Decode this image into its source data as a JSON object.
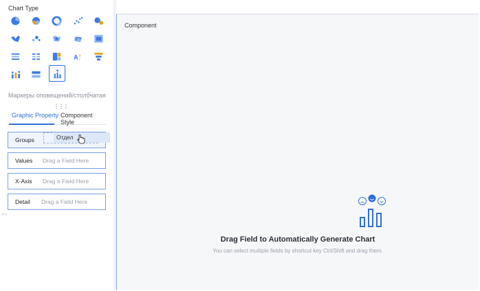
{
  "left_panel": {
    "chart_type_title": "Chart Type",
    "chart_icons": [
      {
        "name": "pie-icon",
        "color": "#3b7be6"
      },
      {
        "name": "rose-pie-icon",
        "color": "#3b7be6"
      },
      {
        "name": "donut-icon",
        "color": "#3b7be6"
      },
      {
        "name": "scatter-icon",
        "color": "#3b7be6"
      },
      {
        "name": "bubble-icon",
        "color": "#3b7be6"
      },
      {
        "name": "map-fill-icon",
        "color": "#3b7be6"
      },
      {
        "name": "map-bubble-icon",
        "color": "#3b7be6"
      },
      {
        "name": "map-heat-icon",
        "color": "#3b7be6"
      },
      {
        "name": "map-flow-icon",
        "color": "#3b7be6"
      },
      {
        "name": "heat-grid-icon",
        "color": "#3b7be6"
      },
      {
        "name": "table-list-icon",
        "color": "#3b7be6"
      },
      {
        "name": "cross-table-icon",
        "color": "#3b7be6"
      },
      {
        "name": "treemap-icon",
        "color": "#3b7be6"
      },
      {
        "name": "word-cloud-icon",
        "color": "#3b7be6"
      },
      {
        "name": "funnel-icon",
        "color": "#e0a21a"
      },
      {
        "name": "dot-bar-icon",
        "color": "#3b7be6"
      },
      {
        "name": "text-bar-icon",
        "color": "#3b7be6"
      },
      {
        "name": "alert-marker-bar-icon",
        "color": "#3b7be6",
        "selected": true
      }
    ],
    "chart_name": "Маркеры оповещений/столбчатая",
    "tabs": [
      {
        "label": "Graphic Property",
        "active": true
      },
      {
        "label": "Component Style",
        "active": false
      }
    ],
    "field_slots": [
      {
        "label": "Groups",
        "placeholder": ""
      },
      {
        "label": "Values",
        "placeholder": "Drag a Field Here"
      },
      {
        "label": "X-Axis",
        "placeholder": "Drag a Field Here"
      },
      {
        "label": "Detail",
        "placeholder": "Drag a Field Here"
      }
    ],
    "dragging_field": "Отдел"
  },
  "canvas": {
    "title": "Component",
    "empty_state_title": "Drag Field to Automatically Generate Chart",
    "empty_state_hint": "You can select multiple fields by shortcut key Ctrl/Shift and drag them.",
    "accent_color": "#2f6fd6"
  }
}
